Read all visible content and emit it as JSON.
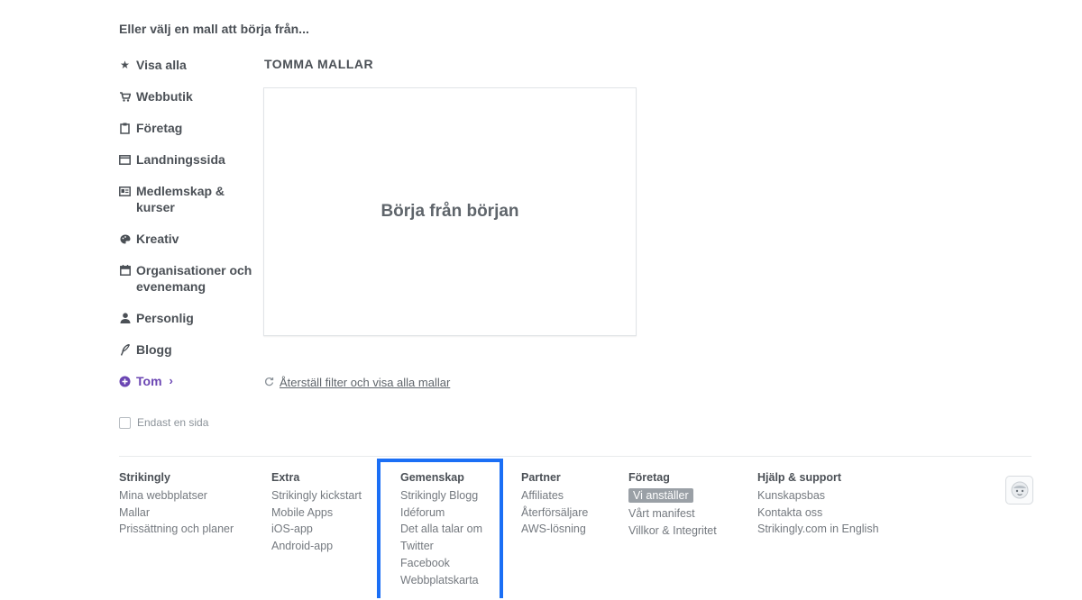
{
  "intro": "Eller välj en mall att börja från...",
  "sidebar": {
    "items": [
      {
        "label": "Visa alla",
        "icon": "star-icon"
      },
      {
        "label": "Webbutik",
        "icon": "cart-icon"
      },
      {
        "label": "Företag",
        "icon": "clipboard-icon"
      },
      {
        "label": "Landningssida",
        "icon": "window-icon"
      },
      {
        "label": "Medlemskap &",
        "label2": "kurser",
        "icon": "id-card-icon"
      },
      {
        "label": "Kreativ",
        "icon": "palette-icon"
      },
      {
        "label": "Organisationer och",
        "label2": "evenemang",
        "icon": "calendar-icon"
      },
      {
        "label": "Personlig",
        "icon": "person-icon"
      },
      {
        "label": "Blogg",
        "icon": "feather-icon"
      },
      {
        "label": "Tom",
        "icon": "plus-circle-icon",
        "accent": "#6b46b3"
      }
    ],
    "one_page": "Endast en sida"
  },
  "main": {
    "section_title": "TOMMA MALLAR",
    "blank_card_label": "Börja från början",
    "reset_link": "Återställ filter och visa alla mallar"
  },
  "footer": {
    "cols": [
      {
        "head": "Strikingly",
        "links": [
          "Mina webbplatser",
          "Mallar",
          "Prissättning och planer"
        ]
      },
      {
        "head": "Extra",
        "links": [
          "Strikingly kickstart",
          "Mobile Apps",
          "iOS-app",
          "Android-app"
        ]
      },
      {
        "head": "Gemenskap",
        "links": [
          "Strikingly Blogg",
          "Idéforum",
          "Det alla talar om",
          "Twitter",
          "Facebook",
          "Webbplatskarta"
        ]
      },
      {
        "head": "Partner",
        "links": [
          "Affiliates",
          "Återförsäljare",
          "AWS-lösning"
        ]
      },
      {
        "head": "Företag",
        "badge": "Vi anställer",
        "links": [
          "Vårt manifest",
          "Villkor & Integritet"
        ]
      },
      {
        "head": "Hjälp & support",
        "links": [
          "Kunskapsbas",
          "Kontakta oss",
          "Strikingly.com in English"
        ]
      }
    ]
  },
  "colors": {
    "accent": "#6b46b3",
    "highlight": "#1b6ff5"
  }
}
